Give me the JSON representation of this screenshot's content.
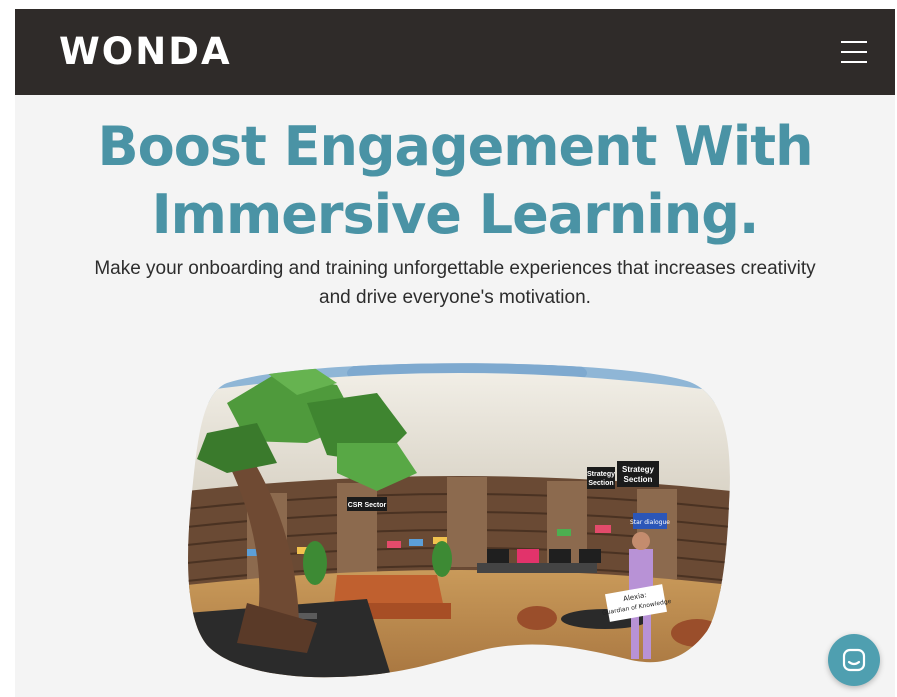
{
  "header": {
    "logo_text": "WONDA",
    "menu_icon": "hamburger-menu-icon"
  },
  "hero": {
    "title_line1": "Boost Engagement With",
    "title_line2": "Immersive Learning.",
    "subtitle_line1": "Make your onboarding and training unforgettable experiences that increases creativity",
    "subtitle_line2": "and drive everyone's motivation."
  },
  "vr_scene": {
    "sign_strategy_left": "Strategy",
    "sign_strategy_left2": "Section",
    "sign_strategy_right": "Strategy",
    "sign_strategy_right2": "Section",
    "sign_csr": "CSR Sector",
    "sign_star": "Star dialogue",
    "avatar_label1": "Alexia:",
    "avatar_label2": "Guardian of Knowledge"
  },
  "chat": {
    "icon": "chat-bubble-icon"
  },
  "colors": {
    "navbar_bg": "#2f2b29",
    "title": "#4a93a5",
    "chat_button": "#4f9fb0",
    "page_bg": "#f4f4f4"
  }
}
